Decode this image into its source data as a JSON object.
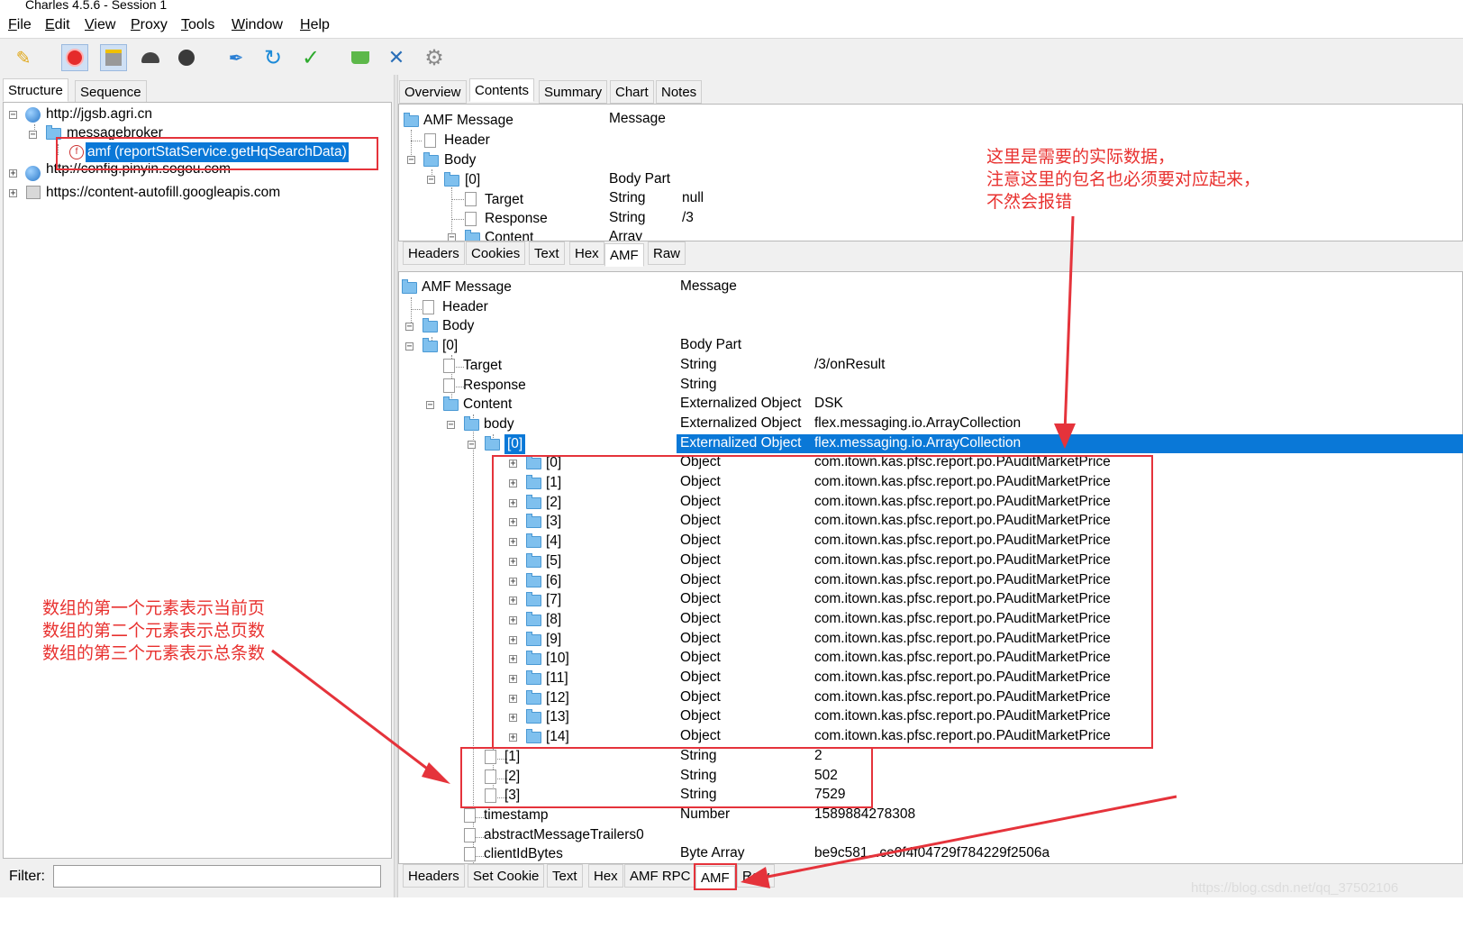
{
  "window": {
    "title": "Charles 4.5.6 - Session 1"
  },
  "menu": [
    "File",
    "Edit",
    "View",
    "Proxy",
    "Tools",
    "Window",
    "Help"
  ],
  "toolbar_icons": [
    "broom-icon",
    "record-icon",
    "throttle-icon",
    "turtle-icon",
    "stop-icon",
    "pen-icon",
    "refresh-icon",
    "check-icon",
    "basket-icon",
    "tools-icon",
    "settings-icon"
  ],
  "left": {
    "tabs": [
      "Structure",
      "Sequence"
    ],
    "tree": [
      "http://jgsb.agri.cn",
      "messagebroker",
      "amf (reportStatService.getHqSearchData)",
      "http://config.pinyin.sogou.com",
      "https://content-autofill.googleapis.com"
    ],
    "filter_label": "Filter:",
    "filter_value": ""
  },
  "right": {
    "top_tabs": [
      "Overview",
      "Contents",
      "Summary",
      "Chart",
      "Notes"
    ],
    "request_tree": [
      {
        "name": "AMF Message",
        "type": "Message",
        "value": ""
      },
      {
        "name": "Header",
        "type": "",
        "value": ""
      },
      {
        "name": "Body",
        "type": "",
        "value": ""
      },
      {
        "name": "[0]",
        "type": "Body Part",
        "value": ""
      },
      {
        "name": "Target",
        "type": "String",
        "value": "null"
      },
      {
        "name": "Response",
        "type": "String",
        "value": "/3"
      },
      {
        "name": "Content",
        "type": "Array",
        "value": ""
      }
    ],
    "request_tabs": [
      "Headers",
      "Cookies",
      "Text",
      "Hex",
      "AMF",
      "Raw"
    ],
    "response_tree": [
      {
        "name": "AMF Message",
        "type": "Message",
        "value": ""
      },
      {
        "name": "Header",
        "type": "",
        "value": ""
      },
      {
        "name": "Body",
        "type": "",
        "value": ""
      },
      {
        "name": "[0]",
        "type": "Body Part",
        "value": ""
      },
      {
        "name": "Target",
        "type": "String",
        "value": "/3/onResult"
      },
      {
        "name": "Response",
        "type": "String",
        "value": ""
      },
      {
        "name": "Content",
        "type": "Externalized Object",
        "value": "DSK"
      },
      {
        "name": "body",
        "type": "Externalized Object",
        "value": "flex.messaging.io.ArrayCollection"
      },
      {
        "name": "[0]",
        "type": "Externalized Object",
        "value": "flex.messaging.io.ArrayCollection"
      },
      {
        "name": "[0]",
        "type": "Object",
        "value": "com.itown.kas.pfsc.report.po.PAuditMarketPrice"
      },
      {
        "name": "[1]",
        "type": "Object",
        "value": "com.itown.kas.pfsc.report.po.PAuditMarketPrice"
      },
      {
        "name": "[2]",
        "type": "Object",
        "value": "com.itown.kas.pfsc.report.po.PAuditMarketPrice"
      },
      {
        "name": "[3]",
        "type": "Object",
        "value": "com.itown.kas.pfsc.report.po.PAuditMarketPrice"
      },
      {
        "name": "[4]",
        "type": "Object",
        "value": "com.itown.kas.pfsc.report.po.PAuditMarketPrice"
      },
      {
        "name": "[5]",
        "type": "Object",
        "value": "com.itown.kas.pfsc.report.po.PAuditMarketPrice"
      },
      {
        "name": "[6]",
        "type": "Object",
        "value": "com.itown.kas.pfsc.report.po.PAuditMarketPrice"
      },
      {
        "name": "[7]",
        "type": "Object",
        "value": "com.itown.kas.pfsc.report.po.PAuditMarketPrice"
      },
      {
        "name": "[8]",
        "type": "Object",
        "value": "com.itown.kas.pfsc.report.po.PAuditMarketPrice"
      },
      {
        "name": "[9]",
        "type": "Object",
        "value": "com.itown.kas.pfsc.report.po.PAuditMarketPrice"
      },
      {
        "name": "[10]",
        "type": "Object",
        "value": "com.itown.kas.pfsc.report.po.PAuditMarketPrice"
      },
      {
        "name": "[11]",
        "type": "Object",
        "value": "com.itown.kas.pfsc.report.po.PAuditMarketPrice"
      },
      {
        "name": "[12]",
        "type": "Object",
        "value": "com.itown.kas.pfsc.report.po.PAuditMarketPrice"
      },
      {
        "name": "[13]",
        "type": "Object",
        "value": "com.itown.kas.pfsc.report.po.PAuditMarketPrice"
      },
      {
        "name": "[14]",
        "type": "Object",
        "value": "com.itown.kas.pfsc.report.po.PAuditMarketPrice"
      },
      {
        "name": "[1]",
        "type": "String",
        "value": "2"
      },
      {
        "name": "[2]",
        "type": "String",
        "value": "502"
      },
      {
        "name": "[3]",
        "type": "String",
        "value": "7529"
      },
      {
        "name": "timestamp",
        "type": "Number",
        "value": "1589884278308"
      },
      {
        "name": "abstractMessageTrailers0",
        "type": "",
        "value": ""
      },
      {
        "name": "clientIdBytes",
        "type": "Byte Array",
        "value": "be9c581...ce0f4f04729f784229f2506a"
      }
    ],
    "response_tabs": [
      "Headers",
      "Set Cookie",
      "Text",
      "Hex",
      "AMF RPC",
      "AMF",
      "Raw"
    ]
  },
  "annotations": {
    "right_note": [
      "这里是需要的实际数据，",
      "注意这里的包名也必须要对应起来，",
      "不然会报错"
    ],
    "left_note": [
      "数组的第一个元素表示当前页",
      "数组的第二个元素表示总页数",
      "数组的第三个元素表示总条数"
    ]
  },
  "watermark": "https://blog.csdn.net/qq_37502106",
  "colors": {
    "selection": "#0a78d7",
    "annotation": "#e8312f"
  }
}
